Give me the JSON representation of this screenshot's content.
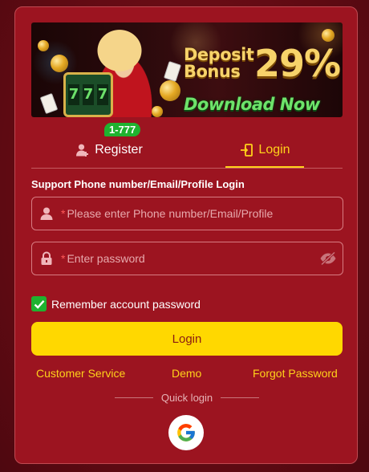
{
  "banner": {
    "line1": "Deposit",
    "line2": "Bonus",
    "percent": "29%",
    "line3": "Download Now",
    "reels": [
      "7",
      "7",
      "7"
    ]
  },
  "tabs": {
    "register_label": "Register",
    "register_badge": "1-777",
    "login_label": "Login",
    "active": "login"
  },
  "form": {
    "support_text": "Support Phone number/Email/Profile Login",
    "account_star": "*",
    "account_placeholder": "Please enter Phone number/Email/Profile",
    "account_value": "",
    "password_star": "*",
    "password_placeholder": "Enter password",
    "password_value": "",
    "remember_label": "Remember account password",
    "remember_checked": true,
    "login_button": "Login"
  },
  "links": {
    "customer_service": "Customer Service",
    "demo": "Demo",
    "forgot_password": "Forgot Password"
  },
  "quick_login": {
    "label": "Quick login",
    "providers": [
      "google-icon"
    ]
  },
  "colors": {
    "panel": "#9c1420",
    "accent": "#ffd21a",
    "button": "#ffd800",
    "badge": "#1fb22f"
  }
}
